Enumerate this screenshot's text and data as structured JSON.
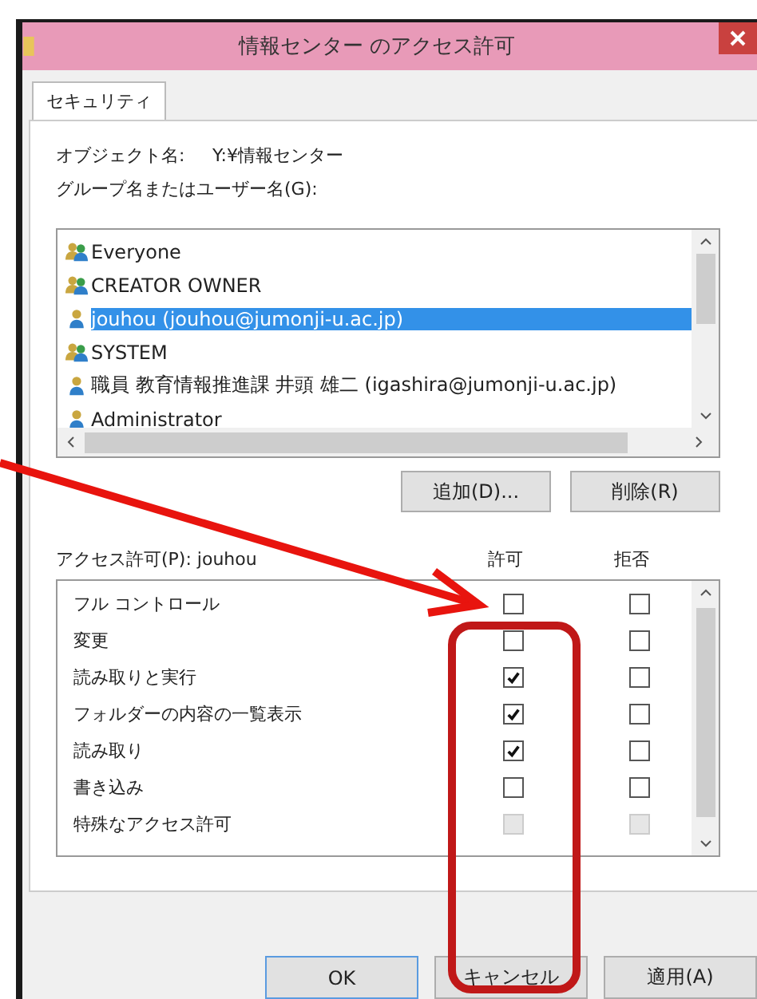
{
  "window": {
    "title": "情報センター のアクセス許可"
  },
  "tabs": [
    {
      "label": "セキュリティ",
      "selected": true
    }
  ],
  "object_name": {
    "label": "オブジェクト名:",
    "value": "Y:¥情報センター"
  },
  "principals": {
    "label": "グループ名またはユーザー名(G):",
    "items": [
      {
        "name": "Everyone",
        "kind": "group",
        "selected": false
      },
      {
        "name": "CREATOR OWNER",
        "kind": "group",
        "selected": false
      },
      {
        "name": "jouhou (jouhou@jumonji-u.ac.jp)",
        "kind": "user",
        "selected": true
      },
      {
        "name": "SYSTEM",
        "kind": "group",
        "selected": false
      },
      {
        "name": "職員 教育情報推進課 井頭 雄二 (igashira@jumonji-u.ac.jp)",
        "kind": "user",
        "selected": false
      },
      {
        "name": "Administrator",
        "kind": "user",
        "selected": false
      }
    ]
  },
  "principal_buttons": [
    "追加(D)...",
    "削除(R)"
  ],
  "permissions": {
    "label": "アクセス許可(P): jouhou",
    "columns": [
      "許可",
      "拒否"
    ],
    "rows": [
      {
        "name": "フル コントロール",
        "allow": false,
        "deny": false,
        "disabled": false
      },
      {
        "name": "変更",
        "allow": false,
        "deny": false,
        "disabled": false
      },
      {
        "name": "読み取りと実行",
        "allow": true,
        "deny": false,
        "disabled": false
      },
      {
        "name": "フォルダーの内容の一覧表示",
        "allow": true,
        "deny": false,
        "disabled": false
      },
      {
        "name": "読み取り",
        "allow": true,
        "deny": false,
        "disabled": false
      },
      {
        "name": "書き込み",
        "allow": false,
        "deny": false,
        "disabled": false
      },
      {
        "name": "特殊なアクセス許可",
        "allow": false,
        "deny": false,
        "disabled": true
      }
    ]
  },
  "buttons": [
    {
      "label": "OK",
      "default": true
    },
    {
      "label": "キャンセル",
      "default": false
    },
    {
      "label": "適用(A)",
      "default": false
    }
  ]
}
